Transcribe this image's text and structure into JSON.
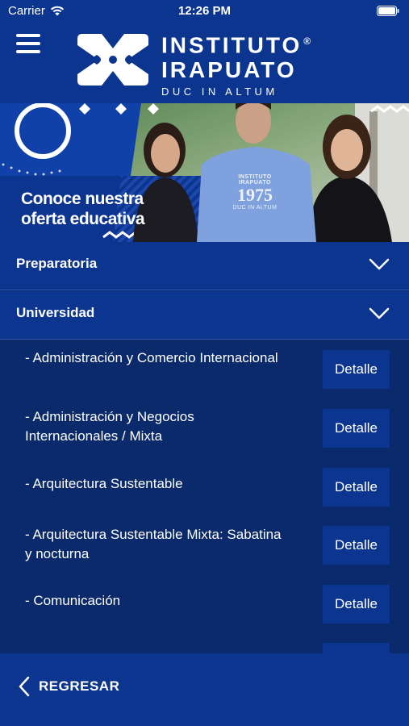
{
  "status_bar": {
    "carrier": "Carrier",
    "time": "12:26 PM"
  },
  "header": {
    "logo_line1": "INSTITUTO",
    "logo_line2": "IRAPUATO",
    "logo_registered": "®",
    "logo_motto": "DUC IN ALTUM"
  },
  "banner": {
    "caption_line1": "Conoce nuestra",
    "caption_line2": "oferta educativa",
    "shirt_line1": "INSTITUTO IRAPUATO",
    "shirt_number": "1975",
    "shirt_line2": "DUC IN ALTUM"
  },
  "sections": [
    {
      "label": "Preparatoria"
    },
    {
      "label": "Universidad"
    }
  ],
  "programs": [
    {
      "label": "- Administración y Comercio Internacional",
      "button": "Detalle"
    },
    {
      "label": "- Administración y Negocios Internacionales / Mixta",
      "button": "Detalle"
    },
    {
      "label": "- Arquitectura Sustentable",
      "button": "Detalle"
    },
    {
      "label": "- Arquitectura Sustentable Mixta: Sabatina y nocturna",
      "button": "Detalle"
    },
    {
      "label": "- Comunicación",
      "button": "Detalle"
    },
    {
      "label": "",
      "button": ""
    }
  ],
  "footer": {
    "back_label": "REGRESAR"
  },
  "colors": {
    "primary": "#0c3590",
    "list_background": "#0a2a6b",
    "text": "#ffffff"
  },
  "icons": [
    "wifi-icon",
    "battery-icon",
    "hamburger-menu-icon",
    "chevron-down-icon",
    "chevron-left-icon",
    "logo-mark-icon"
  ]
}
